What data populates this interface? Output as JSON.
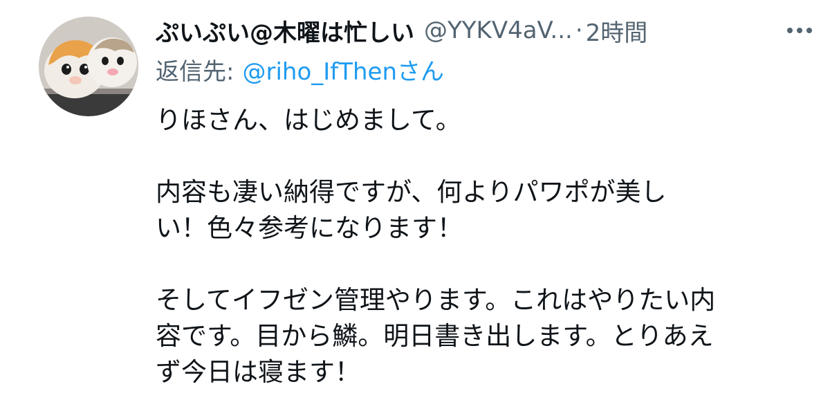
{
  "tweet": {
    "display_name": "ぷいぷい@木曜は忙しい",
    "handle": "@YYKV4aV...",
    "separator": "·",
    "time": "2時間",
    "more_icon": "ellipsis-icon",
    "reply_prefix": "返信先:",
    "reply_target": "@riho_IfThenさん",
    "body": [
      "りほさん、はじめまして。",
      "内容も凄い納得ですが、何よりパワポが美し\nい！色々参考になります！",
      "そしてイフゼン管理やります。これはやりたい内\n容です。目から鱗。明日書き出します。とりあえ\nず今日は寝ます！"
    ]
  },
  "colors": {
    "text_primary": "#0f1419",
    "text_secondary": "#536471",
    "link": "#1d9bf0",
    "background": "#ffffff"
  }
}
